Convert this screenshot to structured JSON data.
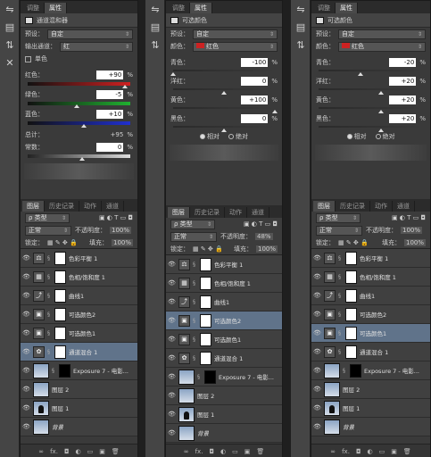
{
  "panel_tabs": [
    "调整",
    "属性"
  ],
  "layers_tabs": [
    "图层",
    "历史记录",
    "动作",
    "通道"
  ],
  "p1": {
    "title": "通道混和器",
    "preset_label": "预设：",
    "preset": "自定",
    "channel_label": "输出通道：",
    "channel": "红",
    "mono": "单色",
    "sliders": [
      {
        "label": "红色：",
        "value": "+90",
        "pct": "%",
        "pos": 0.95
      },
      {
        "label": "绿色：",
        "value": "-5",
        "pct": "%",
        "pos": 0.48
      },
      {
        "label": "蓝色：",
        "value": "+10",
        "pct": "%",
        "pos": 0.55
      }
    ],
    "total_label": "总计：",
    "total": "+95",
    "total_pct": "%",
    "const_label": "常数：",
    "const": "0",
    "const_pct": "%"
  },
  "p2": {
    "title": "可选颜色",
    "preset_label": "预设：",
    "preset": "自定",
    "color_label": "颜色：",
    "color": "红色",
    "sliders": [
      {
        "label": "青色：",
        "value": "-100",
        "pct": "%",
        "pos": 0.0
      },
      {
        "label": "洋红：",
        "value": "0",
        "pct": "%",
        "pos": 0.5
      },
      {
        "label": "黄色：",
        "value": "+100",
        "pct": "%",
        "pos": 1.0
      },
      {
        "label": "黑色：",
        "value": "0",
        "pct": "%",
        "pos": 0.5
      }
    ],
    "rel": "相对",
    "abs": "绝对"
  },
  "p3": {
    "title": "可选颜色",
    "preset_label": "预设：",
    "preset": "自定",
    "color_label": "颜色：",
    "color": "红色",
    "sliders": [
      {
        "label": "青色：",
        "value": "-20",
        "pct": "%",
        "pos": 0.4
      },
      {
        "label": "洋红：",
        "value": "+20",
        "pct": "%",
        "pos": 0.6
      },
      {
        "label": "黄色：",
        "value": "+20",
        "pct": "%",
        "pos": 0.6
      },
      {
        "label": "黑色：",
        "value": "+20",
        "pct": "%",
        "pos": 0.6
      }
    ],
    "rel": "相对",
    "abs": "绝对"
  },
  "layers": {
    "kind": "类型",
    "blend": "正常",
    "opacity_label": "不透明度：",
    "opacity_1": "100%",
    "opacity_2": "48%",
    "opacity_3": "100%",
    "lock_label": "锁定：",
    "fill_label": "填充：",
    "fill": "100%",
    "rows": [
      {
        "name": "色彩平衡 1",
        "icon": "⚖"
      },
      {
        "name": "色相/饱和度 1",
        "icon": "▦"
      },
      {
        "name": "曲线1",
        "icon": "⤴"
      },
      {
        "name": "可选颜色2",
        "icon": "▣"
      },
      {
        "name": "可选颜色1",
        "icon": "▣"
      },
      {
        "name": "通道混合 1",
        "icon": "✿"
      },
      {
        "name": "Exposure 7 - 电影...",
        "icon": ""
      },
      {
        "name": "图层 2",
        "icon": ""
      },
      {
        "name": "图层 1",
        "icon": ""
      },
      {
        "name": "背景",
        "icon": ""
      }
    ]
  },
  "bottom_icons": [
    "∞",
    "fx.",
    "◘",
    "◐",
    "▭",
    "▣",
    "🗑"
  ],
  "colors": {
    "selected": "#60738a",
    "red": "#cc2222"
  }
}
